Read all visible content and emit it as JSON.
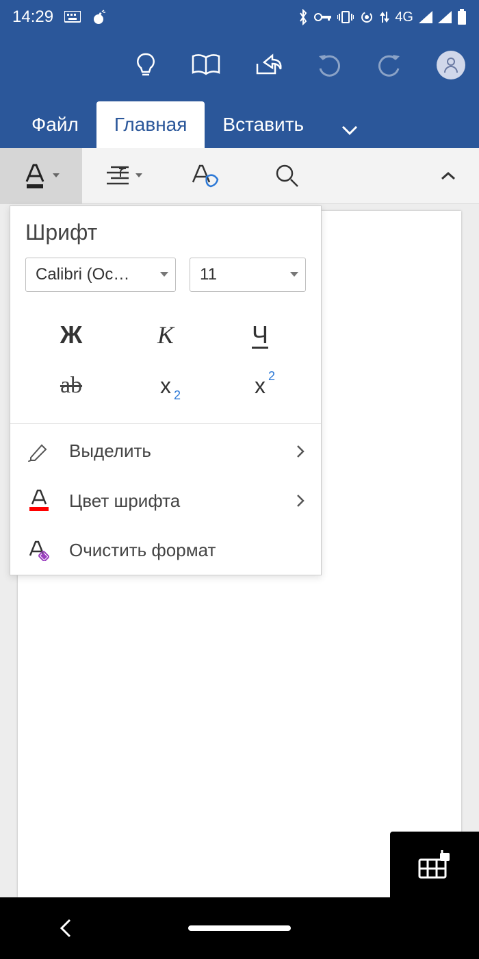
{
  "status": {
    "time": "14:29",
    "network_label": "4G"
  },
  "tabs": {
    "file": "Файл",
    "home": "Главная",
    "insert": "Вставить"
  },
  "font_panel": {
    "title": "Шрифт",
    "font_name": "Calibri (Ос…",
    "font_size": "11",
    "bold": "Ж",
    "italic": "К",
    "underline": "Ч",
    "strike": "ab",
    "sub_base": "x",
    "sub_scr": "2",
    "sup_base": "x",
    "sup_scr": "2",
    "highlight": "Выделить",
    "font_color": "Цвет шрифта",
    "clear_format": "Очистить формат"
  }
}
